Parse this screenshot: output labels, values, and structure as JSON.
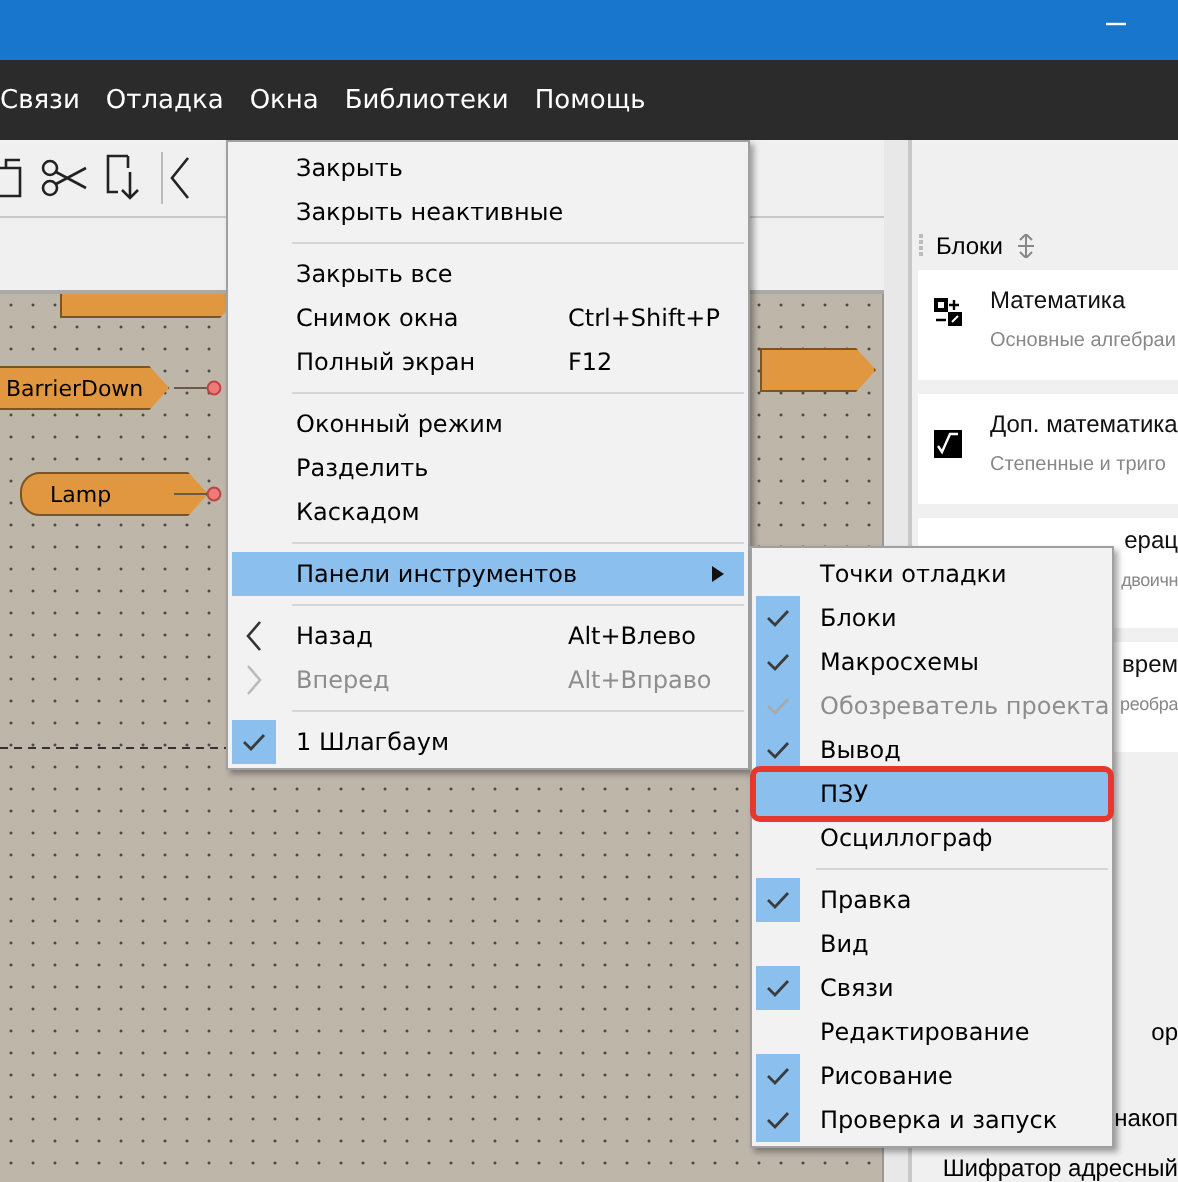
{
  "menubar": [
    "Связи",
    "Отладка",
    "Окна",
    "Библиотеки",
    "Помощь"
  ],
  "canvas": {
    "blocks": [
      {
        "kind": "cut"
      },
      {
        "label": "BarrierDown",
        "kind": "input"
      },
      {
        "label": "Lamp",
        "kind": "output"
      }
    ]
  },
  "blocks_panel": {
    "title": "Блоки",
    "cards": [
      {
        "title": "Математика",
        "subtitle": "Основные алгебраи",
        "kind": "math"
      },
      {
        "title": "Доп. математика",
        "subtitle": "Степенные и триго",
        "kind": "sqrt"
      },
      {
        "title": "ерац",
        "subtitle": "двоичн",
        "kind": "partial"
      },
      {
        "title": "врем",
        "subtitle": "реобра",
        "kind": "partial"
      }
    ],
    "list": [
      "ор",
      "накоп",
      "Шифратор адресный"
    ]
  },
  "window_menu": {
    "sections": [
      [
        {
          "label": "Закрыть"
        },
        {
          "label": "Закрыть неактивные"
        }
      ],
      [
        {
          "label": "Закрыть все"
        },
        {
          "label": "Снимок окна",
          "shortcut": "Ctrl+Shift+P"
        },
        {
          "label": "Полный экран",
          "shortcut": "F12"
        }
      ],
      [
        {
          "label": "Оконный режим"
        },
        {
          "label": "Разделить"
        },
        {
          "label": "Каскадом"
        }
      ],
      [
        {
          "label": "Панели инструментов",
          "selected": true,
          "submenu": true
        }
      ],
      [
        {
          "label": "Назад",
          "shortcut": "Alt+Влево",
          "kind": "back",
          "disabled": false
        },
        {
          "label": "Вперед",
          "shortcut": "Alt+Вправо",
          "kind": "forward",
          "disabled": true
        }
      ],
      [
        {
          "label": "1 Шлагбаум",
          "checked": true
        }
      ]
    ]
  },
  "toolbars_submenu": {
    "sections": [
      [
        {
          "label": "Точки отладки",
          "checked": false,
          "disabled": false,
          "selected": false
        },
        {
          "label": "Блоки",
          "checked": true,
          "disabled": false,
          "selected": false
        },
        {
          "label": "Макросхемы",
          "checked": true,
          "disabled": false,
          "selected": false
        },
        {
          "label": "Обозреватель проекта",
          "checked": true,
          "disabled": true,
          "selected": false
        },
        {
          "label": "Вывод",
          "checked": true,
          "disabled": false,
          "selected": false
        },
        {
          "label": "ПЗУ",
          "checked": false,
          "disabled": false,
          "selected": true,
          "outlined": true
        },
        {
          "label": "Осциллограф",
          "checked": false,
          "disabled": false,
          "selected": false
        }
      ],
      [
        {
          "label": "Правка",
          "checked": true,
          "disabled": false,
          "selected": false
        },
        {
          "label": "Вид",
          "checked": false,
          "disabled": false,
          "selected": false
        },
        {
          "label": "Связи",
          "checked": true,
          "disabled": false,
          "selected": false
        },
        {
          "label": "Редактирование",
          "checked": false,
          "disabled": false,
          "selected": false
        },
        {
          "label": "Рисование",
          "checked": true,
          "disabled": false,
          "selected": false
        },
        {
          "label": "Проверка и запуск",
          "checked": true,
          "disabled": false,
          "selected": false
        }
      ]
    ]
  }
}
